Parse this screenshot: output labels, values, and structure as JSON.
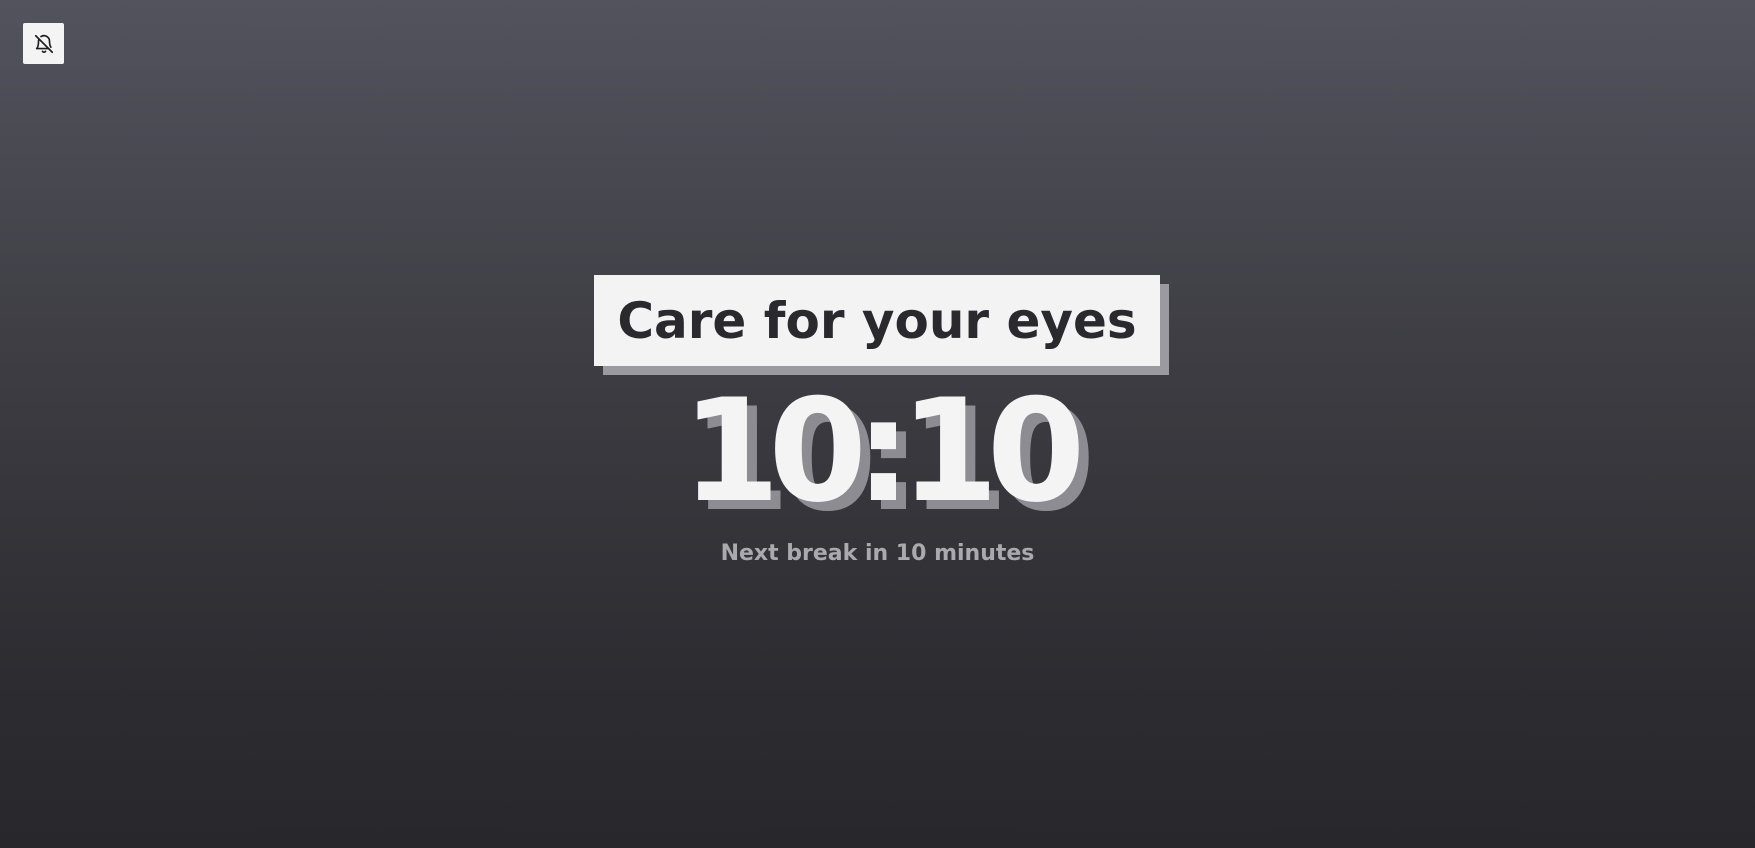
{
  "mute_button": {
    "icon": "bell-off-icon",
    "background": "#f4f4f4",
    "icon_color": "#1f1f1f"
  },
  "title": "Care for your eyes",
  "timer": "10:10",
  "next_break": "Next break in 10 minutes",
  "colors": {
    "title_bg": "#f3f3f3",
    "title_text": "#2a2a2e",
    "timer_text": "#f4f4f4",
    "shadow": "#8c8c92",
    "subtitle_text": "#a9a9ae"
  }
}
